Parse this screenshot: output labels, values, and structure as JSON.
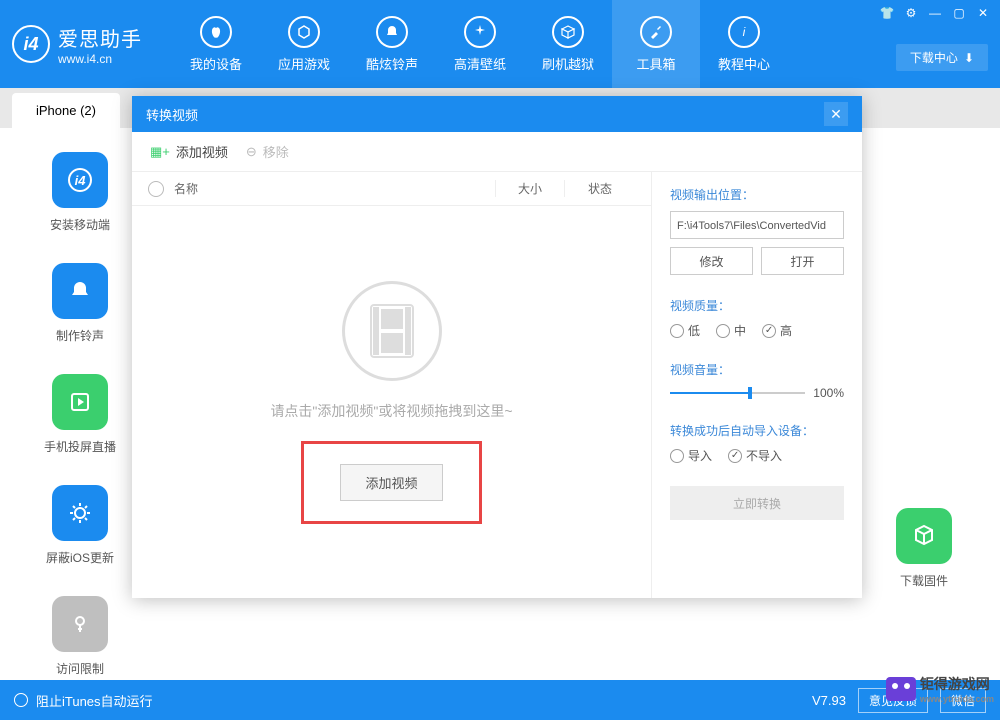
{
  "header": {
    "logo_letter": "i4",
    "app_name": "爱思助手",
    "url": "www.i4.cn",
    "download_center": "下载中心"
  },
  "nav": [
    {
      "label": "我的设备"
    },
    {
      "label": "应用游戏"
    },
    {
      "label": "酷炫铃声"
    },
    {
      "label": "高清壁纸"
    },
    {
      "label": "刷机越狱"
    },
    {
      "label": "工具箱"
    },
    {
      "label": "教程中心"
    }
  ],
  "tab": {
    "label": "iPhone (2)"
  },
  "side_left": [
    {
      "label": "安装移动端",
      "color": "#1b8bef"
    },
    {
      "label": "制作铃声",
      "color": "#1b8bef"
    },
    {
      "label": "手机投屏直播",
      "color": "#3bcf6e"
    },
    {
      "label": "屏蔽iOS更新",
      "color": "#1b8bef"
    },
    {
      "label": "访问限制",
      "color": "#bfbfbf"
    }
  ],
  "side_right": [
    {
      "label": "下载固件",
      "color": "#3bcf6e"
    }
  ],
  "modal": {
    "title": "转换视频",
    "toolbar": {
      "add": "添加视频",
      "remove": "移除"
    },
    "list_header": {
      "name": "名称",
      "size": "大小",
      "status": "状态"
    },
    "drop_hint": "请点击\"添加视频\"或将视频拖拽到这里~",
    "add_btn": "添加视频",
    "settings": {
      "output_label": "视频输出位置：",
      "output_path": "F:\\i4Tools7\\Files\\ConvertedVid",
      "modify": "修改",
      "open": "打开",
      "quality_label": "视频质量：",
      "quality_opts": [
        "低",
        "中",
        "高"
      ],
      "volume_label": "视频音量：",
      "volume_value": "100%",
      "autoimport_label": "转换成功后自动导入设备：",
      "autoimport_opts": [
        "导入",
        "不导入"
      ],
      "convert": "立即转换"
    }
  },
  "statusbar": {
    "itunes": "阻止iTunes自动运行",
    "version": "V7.93",
    "feedback": "意见反馈",
    "weixin": "微信"
  },
  "watermark": {
    "name": "钜得游戏网",
    "url": "www.ytruida.com"
  }
}
